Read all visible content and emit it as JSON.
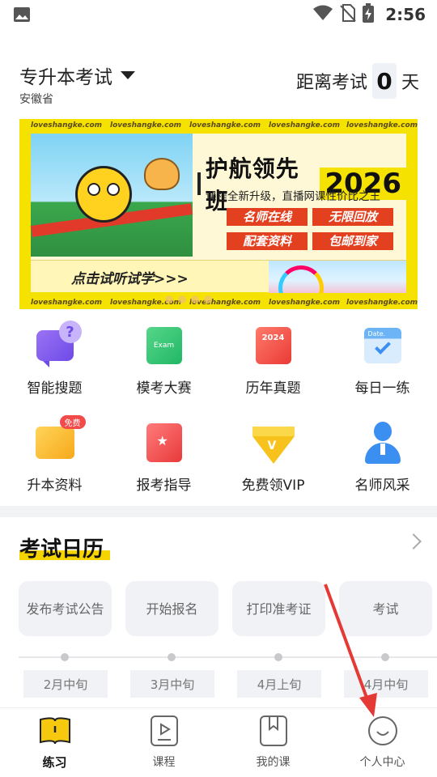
{
  "status_bar": {
    "time": "2:56"
  },
  "header": {
    "exam_title": "专升本考试",
    "province": "安徽省",
    "countdown_label": "距离考试",
    "countdown_value": "0",
    "countdown_unit": "天"
  },
  "banner": {
    "watermark": "loveshangke.com",
    "title": "护航领先班",
    "year": "2026",
    "subtitle": "课程全新升级，直播网课性价比之王",
    "tags": [
      "名师在线",
      "无限回放",
      "配套资料",
      "包邮到家"
    ],
    "trial_text": "点击试听试学>>>"
  },
  "menu": [
    {
      "label": "智能搜题",
      "icon": "smart-search-icon"
    },
    {
      "label": "模考大赛",
      "icon": "mock-exam-icon",
      "icon_text": "Exam"
    },
    {
      "label": "历年真题",
      "icon": "past-papers-icon",
      "icon_text": "2024"
    },
    {
      "label": "每日一练",
      "icon": "daily-practice-icon",
      "icon_text": "Date."
    },
    {
      "label": "升本资料",
      "icon": "materials-folder-icon",
      "badge": "免费"
    },
    {
      "label": "报考指导",
      "icon": "exam-guide-icon"
    },
    {
      "label": "免费领VIP",
      "icon": "vip-diamond-icon",
      "icon_text": "V"
    },
    {
      "label": "名师风采",
      "icon": "teacher-icon"
    }
  ],
  "calendar": {
    "title": "考试日历",
    "steps": [
      {
        "name": "发布考试公告",
        "date": "2月中旬"
      },
      {
        "name": "开始报名",
        "date": "3月中旬"
      },
      {
        "name": "打印准考证",
        "date": "4月上旬"
      },
      {
        "name": "考试",
        "date": "4月中旬"
      }
    ]
  },
  "bottom_nav": [
    {
      "label": "练习",
      "icon": "practice-book-icon",
      "active": true
    },
    {
      "label": "课程",
      "icon": "course-play-icon",
      "active": false
    },
    {
      "label": "我的课",
      "icon": "my-course-bookmark-icon",
      "active": false
    },
    {
      "label": "个人中心",
      "icon": "profile-smile-icon",
      "active": false
    }
  ],
  "colors": {
    "accent": "#f6d400",
    "annotation_arrow": "#e53935"
  }
}
